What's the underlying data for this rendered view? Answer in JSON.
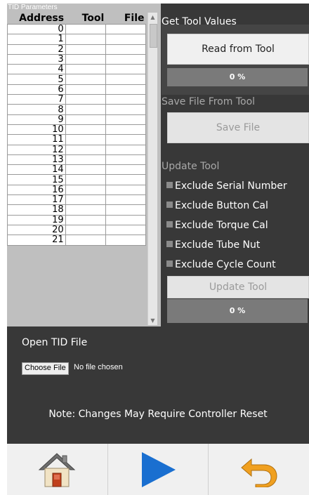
{
  "tid_panel": {
    "title": "TID Parameters",
    "columns": [
      "Address",
      "Tool",
      "File"
    ],
    "rows": [
      {
        "address": "0",
        "tool": "",
        "file": ""
      },
      {
        "address": "1",
        "tool": "",
        "file": ""
      },
      {
        "address": "2",
        "tool": "",
        "file": ""
      },
      {
        "address": "3",
        "tool": "",
        "file": ""
      },
      {
        "address": "4",
        "tool": "",
        "file": ""
      },
      {
        "address": "5",
        "tool": "",
        "file": ""
      },
      {
        "address": "6",
        "tool": "",
        "file": ""
      },
      {
        "address": "7",
        "tool": "",
        "file": ""
      },
      {
        "address": "8",
        "tool": "",
        "file": ""
      },
      {
        "address": "9",
        "tool": "",
        "file": ""
      },
      {
        "address": "10",
        "tool": "",
        "file": ""
      },
      {
        "address": "11",
        "tool": "",
        "file": ""
      },
      {
        "address": "12",
        "tool": "",
        "file": ""
      },
      {
        "address": "13",
        "tool": "",
        "file": ""
      },
      {
        "address": "14",
        "tool": "",
        "file": ""
      },
      {
        "address": "15",
        "tool": "",
        "file": ""
      },
      {
        "address": "16",
        "tool": "",
        "file": ""
      },
      {
        "address": "17",
        "tool": "",
        "file": ""
      },
      {
        "address": "18",
        "tool": "",
        "file": ""
      },
      {
        "address": "19",
        "tool": "",
        "file": ""
      },
      {
        "address": "20",
        "tool": "",
        "file": ""
      },
      {
        "address": "21",
        "tool": "",
        "file": ""
      }
    ]
  },
  "get_tool_values": {
    "title": "Get Tool Values",
    "read_button": "Read from Tool",
    "progress": "0 %"
  },
  "save_file": {
    "title": "Save File From Tool",
    "save_button": "Save File"
  },
  "update_tool": {
    "title": "Update Tool",
    "options": [
      {
        "label": "Exclude Serial Number",
        "checked": false
      },
      {
        "label": "Exclude Button Cal",
        "checked": false
      },
      {
        "label": "Exclude Torque Cal",
        "checked": false
      },
      {
        "label": "Exclude Tube Nut",
        "checked": false
      },
      {
        "label": "Exclude Cycle Count",
        "checked": false
      }
    ],
    "update_button": "Update Tool",
    "progress": "0 %"
  },
  "open_file": {
    "title": "Open TID File",
    "choose_button": "Choose File",
    "status": "No file chosen"
  },
  "note": "Note: Changes May Require Controller Reset",
  "nav": {
    "icons": [
      "home-icon",
      "play-icon",
      "undo-icon"
    ]
  },
  "colors": {
    "background": "#383838",
    "play_blue": "#1a6fd0",
    "undo_orange": "#f0a020"
  }
}
